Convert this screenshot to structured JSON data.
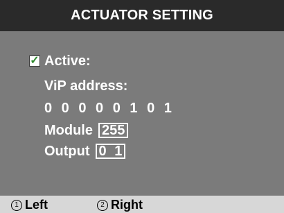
{
  "header": {
    "title": "ACTUATOR SETTING"
  },
  "active": {
    "checked": true,
    "check_glyph": "✓",
    "label": "Active:"
  },
  "vip": {
    "label": "ViP address:",
    "value": "0 0 0 0 0 1 0 1"
  },
  "module": {
    "label": "Module",
    "value": "255"
  },
  "output": {
    "label": "Output",
    "value": "0 1"
  },
  "softkeys": {
    "left": {
      "number": "1",
      "label": "Left"
    },
    "right": {
      "number": "2",
      "label": "Right"
    }
  },
  "colors": {
    "background": "#7b7b7b",
    "header_bg": "#2a2a2a",
    "footer_bg": "#d7d7d7",
    "checkmark": "#2f8a2f",
    "text": "#ffffff"
  }
}
